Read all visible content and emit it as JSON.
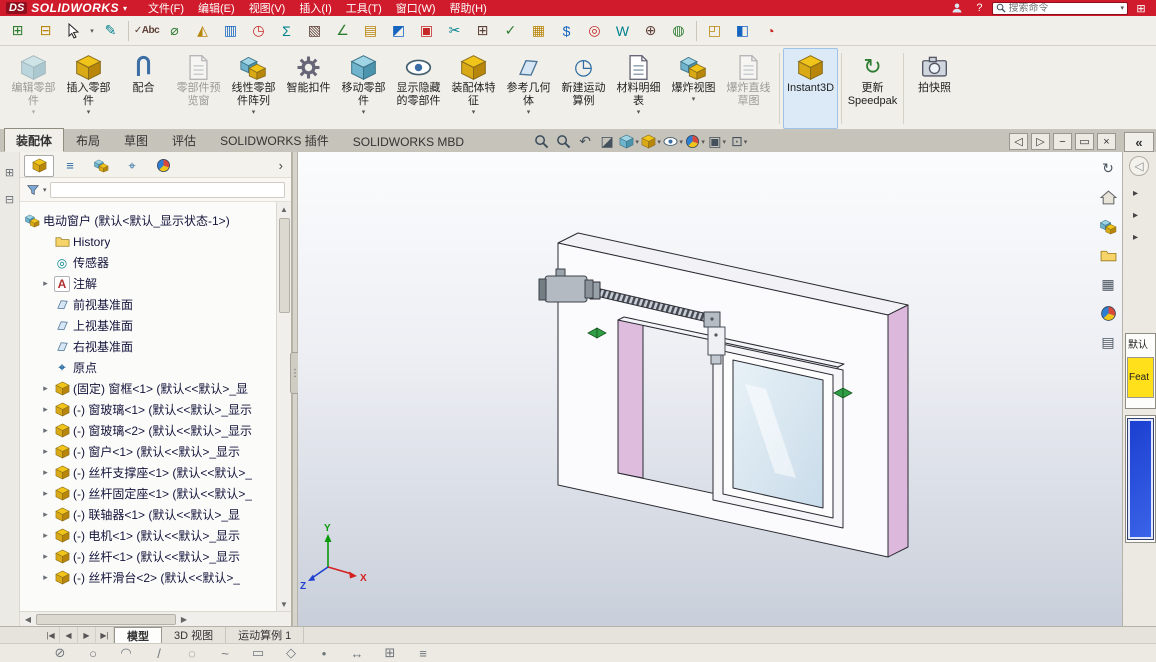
{
  "glyphs": {
    "dropdown": "▾",
    "expand": "▸",
    "more": "›",
    "collapse_pane": "«",
    "up": "▲",
    "down": "▼",
    "left": "◀",
    "right": "▶",
    "first": "|◀",
    "last": "▶|",
    "back": "◁",
    "forward": "▷",
    "minimize": "−",
    "restore": "▭",
    "close": "×",
    "grip": "⋮",
    "pane_expand": "⊞",
    "pane_collapse": "⊟",
    "origin": "⌖",
    "annotation_a": "A",
    "sensor": "◎",
    "help": "?",
    "refresh": "↻",
    "logo_mark": "DS",
    "grid": "⊞",
    "pencil": "✎",
    "section": "◪",
    "previous_view": "↶",
    "scene": "▣",
    "view_settings": "⊡",
    "view_palette": "▦",
    "custom_properties": "▤",
    "motion_study": "◷",
    "speedpak": "↻",
    "list_tab": "≡"
  },
  "titlebar": {
    "logo": "SOLIDWORKS",
    "menus": [
      "文件(F)",
      "编辑(E)",
      "视图(V)",
      "插入(I)",
      "工具(T)",
      "窗口(W)",
      "帮助(H)"
    ],
    "search_placeholder": "搜索命令"
  },
  "toolbar2": {
    "items": [
      {
        "name": "spell-check",
        "glyph": "✓Abc"
      },
      {
        "name": "measure",
        "glyph": "⌀"
      },
      {
        "name": "mass-properties",
        "glyph": "◭"
      },
      {
        "name": "section-properties",
        "glyph": "▥"
      },
      {
        "name": "performance-evaluation",
        "glyph": "◷"
      },
      {
        "name": "statistics",
        "glyph": "Σ"
      },
      {
        "name": "import-diagnostics",
        "glyph": "▧"
      },
      {
        "name": "deviation-analysis",
        "glyph": "∠"
      },
      {
        "name": "zebra-stripes",
        "glyph": "▤"
      },
      {
        "name": "draft-analysis",
        "glyph": "◩"
      },
      {
        "name": "thickness-analysis",
        "glyph": "▣"
      },
      {
        "name": "split-line",
        "glyph": "✂"
      },
      {
        "name": "compare-documents",
        "glyph": "⊞"
      },
      {
        "name": "check-document",
        "glyph": "✓"
      },
      {
        "name": "design-checker",
        "glyph": "▦"
      },
      {
        "name": "costing",
        "glyph": "$"
      },
      {
        "name": "sensors",
        "glyph": "◎"
      },
      {
        "name": "export-word",
        "glyph": "W"
      },
      {
        "name": "hole-alignment",
        "glyph": "⊕"
      },
      {
        "name": "help-globe",
        "glyph": "◍"
      },
      {
        "name": "interference-detection",
        "glyph": "◰"
      },
      {
        "name": "assembly-visualization",
        "glyph": "◧"
      },
      {
        "name": "curvature",
        "glyph": "◔"
      }
    ]
  },
  "ribbon": {
    "buttons": [
      {
        "label": "编辑零部件",
        "disabled": true,
        "dropdown": true
      },
      {
        "label": "插入零部件",
        "dropdown": true
      },
      {
        "label": "配合"
      },
      {
        "label": "零部件预览窗",
        "disabled": true
      },
      {
        "label": "线性零部件阵列",
        "dropdown": true
      },
      {
        "label": "智能扣件"
      },
      {
        "label": "移动零部件",
        "dropdown": true
      },
      {
        "label": "显示隐藏的零部件"
      },
      {
        "label": "装配体特征",
        "dropdown": true
      },
      {
        "label": "参考几何体",
        "dropdown": true
      },
      {
        "label": "新建运动算例"
      },
      {
        "label": "材料明细表",
        "dropdown": true
      },
      {
        "label": "爆炸视图",
        "dropdown": true
      },
      {
        "label": "爆炸直线草图",
        "disabled": true
      },
      {
        "label": "Instant3D",
        "active": true
      },
      {
        "label": "更新 Speedpak"
      },
      {
        "label": "拍快照"
      }
    ]
  },
  "command_tabs": {
    "items": [
      "装配体",
      "布局",
      "草图",
      "评估",
      "SOLIDWORKS 插件",
      "SOLIDWORKS MBD"
    ],
    "active_index": 0
  },
  "tree": {
    "root_label": "电动窗户 (默认<默认_显示状态-1>)",
    "items": [
      {
        "label": "History"
      },
      {
        "label": "传感器"
      },
      {
        "label": "注解"
      },
      {
        "label": "前视基准面"
      },
      {
        "label": "上视基准面"
      },
      {
        "label": "右视基准面"
      },
      {
        "label": "原点"
      },
      {
        "label": "(固定) 窗框<1> (默认<<默认>_显"
      },
      {
        "label": "(-) 窗玻璃<1> (默认<<默认>_显示"
      },
      {
        "label": "(-) 窗玻璃<2> (默认<<默认>_显示"
      },
      {
        "label": "(-) 窗户<1> (默认<<默认>_显示"
      },
      {
        "label": "(-) 丝杆支撑座<1> (默认<<默认>_"
      },
      {
        "label": "(-) 丝杆固定座<1> (默认<<默认>_"
      },
      {
        "label": "(-) 联轴器<1> (默认<<默认>_显"
      },
      {
        "label": "(-) 电机<1> (默认<<默认>_显示"
      },
      {
        "label": "(-) 丝杆<1> (默认<<默认>_显示"
      },
      {
        "label": "(-) 丝杆滑台<2> (默认<<默认>_"
      }
    ]
  },
  "viewport": {
    "triad": {
      "x": "X",
      "y": "Y",
      "z": "Z"
    }
  },
  "right_panels": {
    "config_title": "默认",
    "feature_button": "Feat"
  },
  "doc_tabs": {
    "items": [
      "模型",
      "3D 视图",
      "运动算例 1"
    ],
    "active_index": 0
  },
  "statusbar": {
    "icons": [
      {
        "name": "snap-disable",
        "glyph": "⊘"
      },
      {
        "name": "snap-center",
        "glyph": "○"
      },
      {
        "name": "snap-arc",
        "glyph": "◠"
      },
      {
        "name": "snap-line",
        "glyph": "/"
      },
      {
        "name": "snap-ellipse",
        "glyph": "◌"
      },
      {
        "name": "snap-spline",
        "glyph": "~"
      },
      {
        "name": "snap-rectangle",
        "glyph": "▭"
      },
      {
        "name": "snap-polygon",
        "glyph": "◇"
      },
      {
        "name": "snap-point",
        "glyph": "•"
      },
      {
        "name": "snap-dimension",
        "glyph": "↔"
      },
      {
        "name": "snap-grid",
        "glyph": "⊞"
      },
      {
        "name": "snap-options",
        "glyph": "≡"
      }
    ]
  },
  "icon_map": {
    "magnifier": "svg-circle-handle",
    "part-cube": "svg-gold-isometric-cube",
    "cube-teal": "svg-teal-isometric-cube",
    "assembly": "svg-two-cubes",
    "plane": "svg-parallelogram",
    "folder": "svg-folder",
    "eye": "svg-eye",
    "appearance-sphere": "svg-tricolor-sphere",
    "home": "svg-house",
    "camera": "svg-camera",
    "mate-paperclip": "svg-paperclip",
    "document": "svg-page",
    "gear": "svg-gear",
    "funnel": "svg-funnel",
    "cursor": "svg-ar row-pointer",
    "person": "svg-person"
  }
}
